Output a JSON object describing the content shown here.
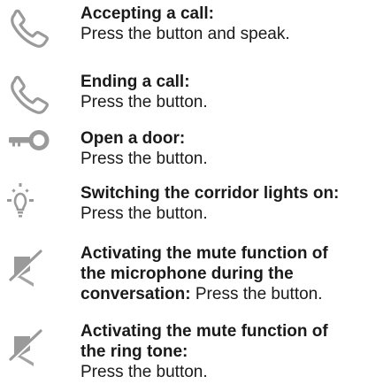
{
  "colors": {
    "text": "#1a1a1a",
    "icon": "#9a9a9a",
    "background": "#ffffff"
  },
  "items": [
    {
      "icon": "phone-handset-icon",
      "title": "Accepting a call:",
      "description": "Press the button and speak."
    },
    {
      "icon": "phone-handset-icon",
      "title": "Ending a call:",
      "description": "Press the button."
    },
    {
      "icon": "key-icon",
      "title": "Open a door:",
      "description": "Press the button."
    },
    {
      "icon": "light-bulb-icon",
      "title": "Switching the corridor lights on:",
      "description": "Press the button."
    },
    {
      "icon": "microphone-mute-icon",
      "title_line1": "Activating the mute function of",
      "title_line2": "the microphone during the",
      "title_line3": "conversation:",
      "description": " Press the button."
    },
    {
      "icon": "ring-tone-mute-icon",
      "title_line1": "Activating the mute function of",
      "title_line2": "the ring tone:",
      "description": "Press the button."
    }
  ]
}
